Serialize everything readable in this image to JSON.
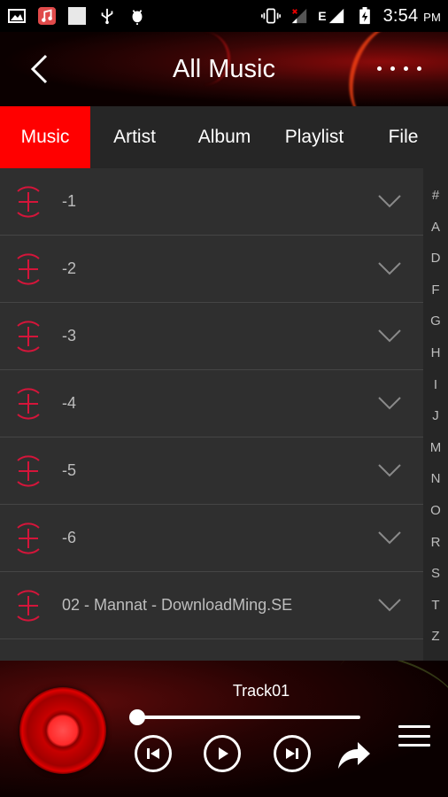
{
  "status_bar": {
    "time": "3:54",
    "ampm": "PM",
    "network_label": "E",
    "icons": [
      "image-icon",
      "music-app-icon",
      "blank-square-icon",
      "usb-icon",
      "android-debug-icon",
      "vibrate-icon",
      "signal-icon",
      "signal-e-icon",
      "battery-charging-icon"
    ]
  },
  "header": {
    "title": "All Music",
    "back_icon": "chevron-left-icon",
    "more_icon": "more-dots-icon"
  },
  "tabs": [
    {
      "label": "Music",
      "active": true
    },
    {
      "label": "Artist",
      "active": false
    },
    {
      "label": "Album",
      "active": false
    },
    {
      "label": "Playlist",
      "active": false
    },
    {
      "label": "File",
      "active": false
    }
  ],
  "songs": [
    {
      "title": "-1"
    },
    {
      "title": "-2"
    },
    {
      "title": "-3"
    },
    {
      "title": "-4"
    },
    {
      "title": "-5"
    },
    {
      "title": "-6"
    },
    {
      "title": "02 - Mannat - DownloadMing.SE"
    }
  ],
  "index_letters": [
    "#",
    "A",
    "D",
    "F",
    "G",
    "H",
    "I",
    "J",
    "M",
    "N",
    "O",
    "R",
    "S",
    "T",
    "Z"
  ],
  "player": {
    "track_title": "Track01",
    "progress": 0.0,
    "controls": [
      "previous-icon",
      "play-icon",
      "next-icon",
      "share-icon",
      "queue-menu-icon"
    ]
  },
  "colors": {
    "accent": "#ff0000",
    "add_icon": "#d4153a",
    "list_bg": "#2f2f2f",
    "tab_bg": "#262626"
  }
}
